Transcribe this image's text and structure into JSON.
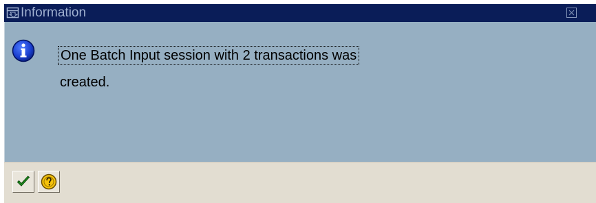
{
  "dialog": {
    "title": "Information",
    "message_line1": "One Batch Input session with 2 transactions was",
    "message_line2": "created."
  },
  "icons": {
    "title": "dialog-window-icon",
    "close": "close-icon",
    "info": "info-icon",
    "continue": "checkmark-icon",
    "help": "question-mark-icon"
  },
  "colors": {
    "titlebar_bg": "#0a1d58",
    "title_text": "#9fb0d0",
    "content_bg": "#96afc2",
    "footer_bg": "#e2ddd1",
    "info_blue": "#1b3fd0",
    "check_green": "#1f8f1f",
    "help_yellow": "#f4c20c"
  }
}
